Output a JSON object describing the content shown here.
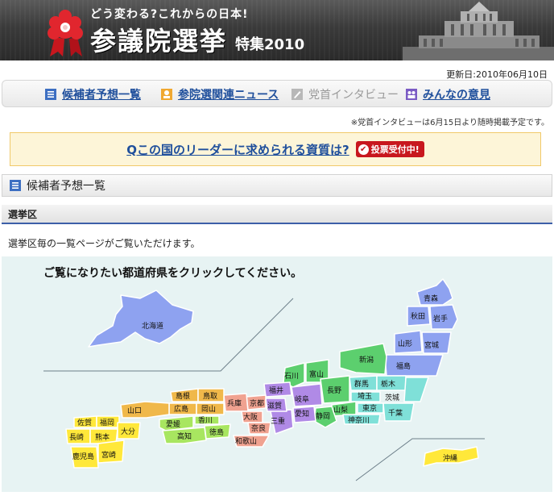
{
  "banner": {
    "tagline": "どう変わる?これからの日本!",
    "title": "参議院選挙",
    "subtitle": "特集2010"
  },
  "updated": "更新日:2010年06月10日",
  "nav": [
    {
      "label": "候補者予想一覧",
      "icon": "list-icon",
      "active": true
    },
    {
      "label": "参院選関連ニュース",
      "icon": "news-icon",
      "active": true
    },
    {
      "label": "党首インタビュー",
      "icon": "interview-icon",
      "active": false
    },
    {
      "label": "みんなの意見",
      "icon": "opinion-icon",
      "active": true
    }
  ],
  "note": "※党首インタビューは6月15日より随時掲載予定です。",
  "question": {
    "text": "Qこの国のリーダーに求められる資質は?",
    "badge": "投票受付中!"
  },
  "section_title": "候補者予想一覧",
  "subsection_title": "選挙区",
  "intro": "選挙区毎の一覧ページがご覧いただけます。",
  "map": {
    "heading": "ご覧になりたい都道府県をクリックしてください。",
    "prefectures": {
      "hokkaido": "北海道",
      "aomori": "青森",
      "akita": "秋田",
      "iwate": "岩手",
      "yamagata": "山形",
      "miyagi": "宮城",
      "fukushima": "福島",
      "niigata": "新潟",
      "ishikawa": "石川",
      "toyama": "富山",
      "fukui": "福井",
      "nagano": "長野",
      "gunma": "群馬",
      "tochigi": "栃木",
      "ibaraki": "茨城",
      "saitama": "埼玉",
      "tokyo": "東京",
      "chiba": "千葉",
      "kanagawa": "神奈川",
      "yamanashi": "山梨",
      "shizuoka": "静岡",
      "aichi": "愛知",
      "gifu": "岐阜",
      "mie": "三重",
      "shiga": "滋賀",
      "kyoto": "京都",
      "osaka": "大阪",
      "nara": "奈良",
      "wakayama": "和歌山",
      "hyogo": "兵庫",
      "tottori": "鳥取",
      "shimane": "島根",
      "okayama": "岡山",
      "hiroshima": "広島",
      "yamaguchi": "山口",
      "kagawa": "香川",
      "tokushima": "徳島",
      "ehime": "愛媛",
      "kochi": "高知",
      "fukuoka": "福岡",
      "saga": "佐賀",
      "nagasaki": "長崎",
      "kumamoto": "熊本",
      "oita": "大分",
      "miyazaki": "宮崎",
      "kagoshima": "鹿児島",
      "okinawa": "沖縄"
    },
    "colors": {
      "hokkaido_tohoku": "#8ea2f0",
      "kanto": "#7fe0d8",
      "chubu": "#5ccf6e",
      "tokai": "#b08ae6",
      "kinki": "#f0a290",
      "chugoku": "#f0b84a",
      "shikoku": "#a8e660",
      "kyushu_okinawa": "#ffe83a"
    }
  }
}
